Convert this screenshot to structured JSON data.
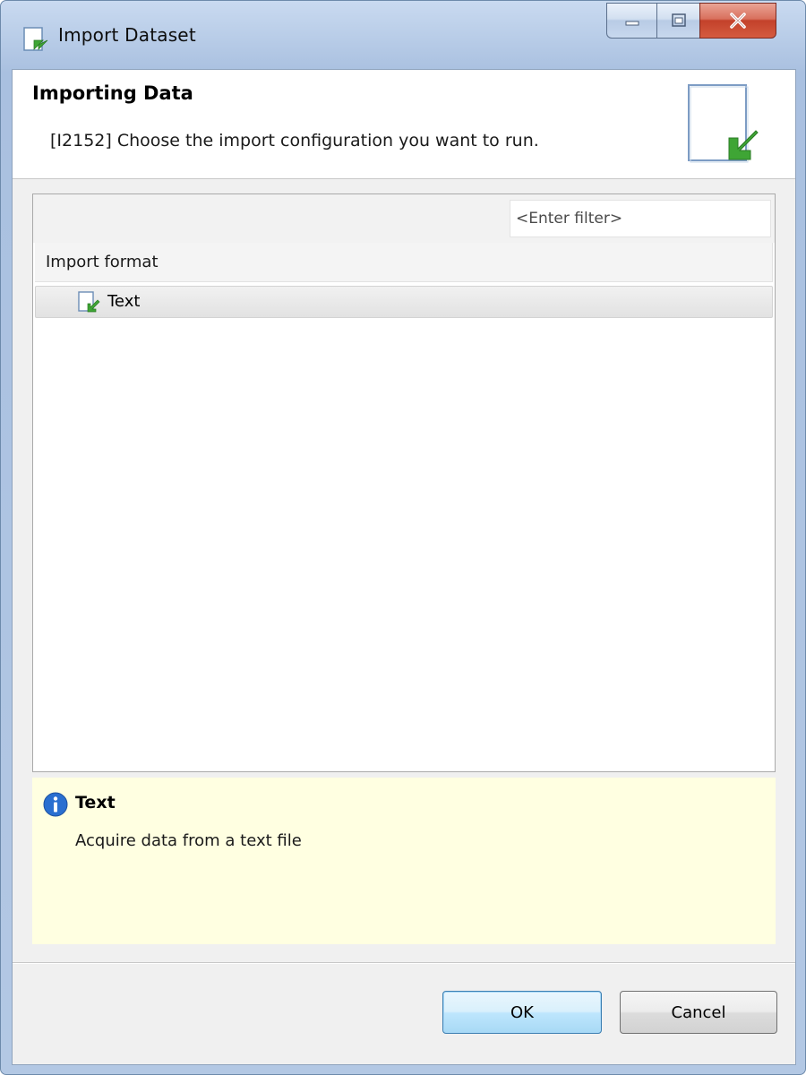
{
  "window": {
    "title": "Import Dataset",
    "icon": "import-document-icon",
    "controls": [
      "minimize-icon",
      "maximize-icon",
      "close-icon"
    ]
  },
  "header": {
    "title": "Importing Data",
    "description": "[I2152] Choose the import configuration you want to run.",
    "icon": "import-document-large-icon"
  },
  "filter": {
    "placeholder": "<Enter filter>",
    "value": ""
  },
  "table": {
    "column_header": "Import format",
    "rows": [
      {
        "label": "Text",
        "icon": "import-document-icon",
        "selected": true
      }
    ]
  },
  "info": {
    "icon": "info-icon",
    "title": "Text",
    "description": "Acquire data from a text file"
  },
  "buttons": {
    "ok": "OK",
    "cancel": "Cancel"
  },
  "colors": {
    "info_background": "#ffffe1",
    "accent_green": "#3fa535",
    "info_blue": "#2a6fd0",
    "close_red": "#c3412a"
  }
}
